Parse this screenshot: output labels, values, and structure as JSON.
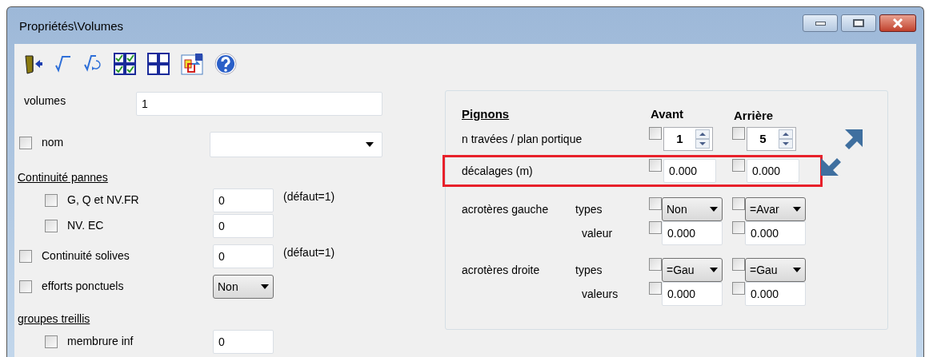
{
  "window": {
    "title": "Propriétés\\Volumes"
  },
  "left_rows": [
    {
      "kind": "field",
      "label": "volumes",
      "value": "1"
    },
    {
      "kind": "check-combo",
      "label": "nom",
      "checked": false
    },
    {
      "kind": "group",
      "heading": "Continuité pannes",
      "children": [
        {
          "kind": "check-field",
          "label": "G, Q et NV.FR",
          "checked": false,
          "value": "0",
          "hint": "(défaut=1)"
        },
        {
          "kind": "check-field",
          "label": "NV. EC",
          "checked": false,
          "value": "0"
        }
      ]
    },
    {
      "kind": "check-field",
      "label": "Continuité solives",
      "checked": false,
      "value": "0",
      "hint": "(défaut=1)"
    },
    {
      "kind": "check-select",
      "label": "efforts ponctuels",
      "checked": false,
      "value": "Non"
    },
    {
      "kind": "group",
      "heading": "groupes treillis",
      "children": [
        {
          "kind": "check-field",
          "label": "membrure inf",
          "checked": false,
          "value": "0"
        }
      ]
    }
  ],
  "pignons": {
    "heading": "Pignons",
    "columns": [
      "Avant",
      "Arrière"
    ],
    "rows": [
      {
        "kind": "spin",
        "label": "n travées / plan portique",
        "highlighted": false,
        "cells": [
          {
            "checked": false,
            "value": "1"
          },
          {
            "checked": false,
            "value": "5"
          }
        ]
      },
      {
        "kind": "field",
        "label": "décalages (m)",
        "highlighted": true,
        "cells": [
          {
            "checked": false,
            "value": "0.000"
          },
          {
            "checked": false,
            "value": "0.000"
          }
        ]
      },
      {
        "kind": "acrotere",
        "label": "acrotères gauche",
        "type_label": "types",
        "value_label": "valeur",
        "highlighted": false,
        "selects": [
          {
            "checked": false,
            "value": "Non"
          },
          {
            "checked": false,
            "value": "=Avar"
          }
        ],
        "fields": [
          {
            "checked": false,
            "value": "0.000"
          },
          {
            "checked": false,
            "value": "0.000"
          }
        ]
      },
      {
        "kind": "acrotere",
        "label": "acrotères droite",
        "type_label": "types",
        "value_label": "valeurs",
        "highlighted": false,
        "selects": [
          {
            "checked": false,
            "value": "=Gau"
          },
          {
            "checked": false,
            "value": "=Gau"
          }
        ],
        "fields": [
          {
            "checked": false,
            "value": "0.000"
          },
          {
            "checked": false,
            "value": "0.000"
          }
        ]
      }
    ]
  }
}
